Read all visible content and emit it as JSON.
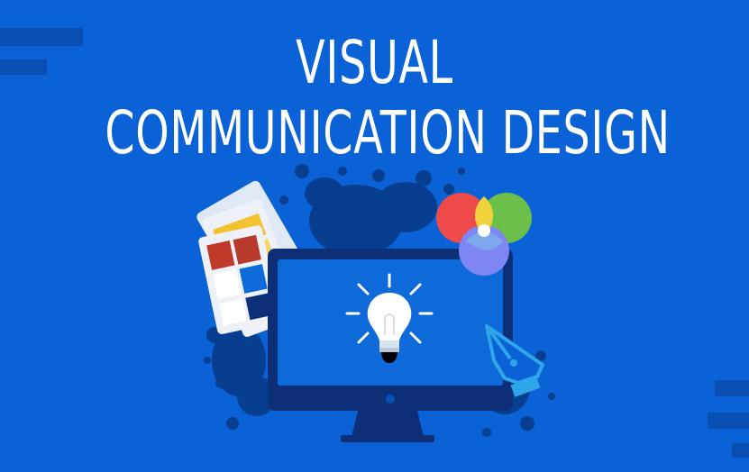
{
  "title": {
    "line1": "VISUAL",
    "line2": "COMMUNICATION DESIGN"
  },
  "colors": {
    "background": "#0a62d6",
    "bar_dark": "#0a4fb3",
    "monitor_frame": "#0c2f78",
    "monitor_screen": "#0e6ad9",
    "splash": "#073e8f",
    "palette_red": "#ef4a4a",
    "palette_green": "#6cc04a",
    "palette_blue": "#7d86f2",
    "swatch_dark_red": "#b73a2c",
    "swatch_yellow": "#f2c230",
    "pen_tool": "#2ea6ea"
  },
  "icons": [
    "lightbulb-icon",
    "color-wheel-icon",
    "pen-tool-icon",
    "color-swatch-icon",
    "monitor-icon"
  ]
}
